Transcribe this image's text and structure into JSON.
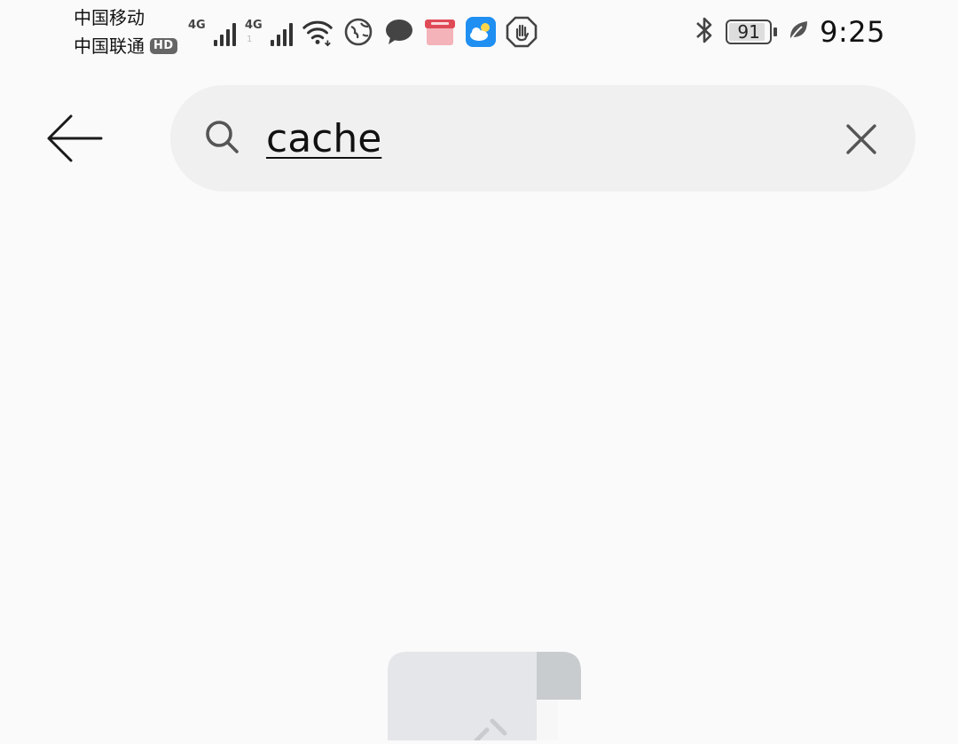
{
  "status_bar": {
    "carrier_1": "中国移动",
    "carrier_2": "中国联通",
    "hd_badge": "HD",
    "network_1": "4G",
    "network_2": "4G",
    "network_2_sub": "1",
    "battery_level": "91",
    "time": "9:25",
    "icons": [
      "signal-icon",
      "wifi-icon",
      "browser-icon",
      "message-icon",
      "app-box-icon",
      "weather-icon",
      "stop-hand-icon",
      "bluetooth-icon",
      "battery-icon",
      "leaf-icon"
    ]
  },
  "search": {
    "query": "cache"
  },
  "colors": {
    "background": "#fafafa",
    "search_field": "#f0f0f0",
    "weather_app": "#1f8ff2"
  }
}
